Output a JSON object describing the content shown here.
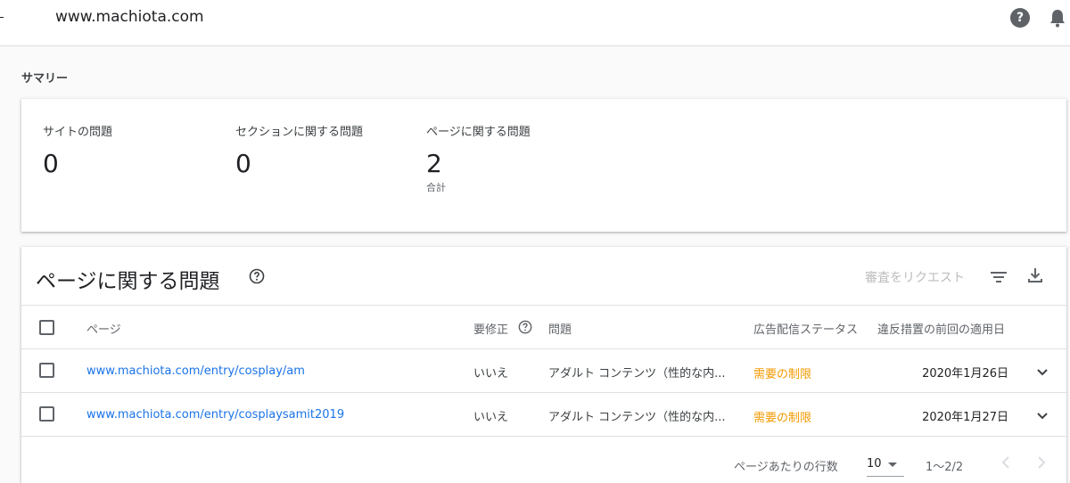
{
  "header": {
    "site": "www.machiota.com",
    "help_icon": "help-circle-icon",
    "bell_icon": "notification-bell-icon"
  },
  "summary": {
    "heading": "サマリー",
    "stats": [
      {
        "label": "サイトの問題",
        "value": "0"
      },
      {
        "label": "セクションに関する問題",
        "value": "0"
      },
      {
        "label": "ページに関する問題",
        "value": "2",
        "sub": "合計"
      }
    ]
  },
  "issues": {
    "title": "ページに関する問題",
    "review_button": "審査をリクエスト",
    "filter_icon": "filter-icon",
    "download_icon": "download-icon",
    "columns": {
      "page": "ページ",
      "needs_fix": "要修正",
      "issue": "問題",
      "ad_status": "広告配信ステータス",
      "last_applied": "違反措置の前回の適用日"
    },
    "rows": [
      {
        "page": "www.machiota.com/entry/cosplay/am",
        "needs_fix": "いいえ",
        "issue": "アダルト コンテンツ（性的な内...",
        "ad_status": "需要の制限",
        "date": "2020年1月26日"
      },
      {
        "page": "www.machiota.com/entry/cosplaysamit2019",
        "needs_fix": "いいえ",
        "issue": "アダルト コンテンツ（性的な内...",
        "ad_status": "需要の制限",
        "date": "2020年1月27日"
      }
    ],
    "pagination": {
      "rows_label": "ページあたりの行数",
      "rows_value": "10",
      "range": "1～2/2"
    }
  },
  "colors": {
    "link": "#1a73e8",
    "status_warning": "#f29900",
    "disabled": "#bdbdbd"
  }
}
